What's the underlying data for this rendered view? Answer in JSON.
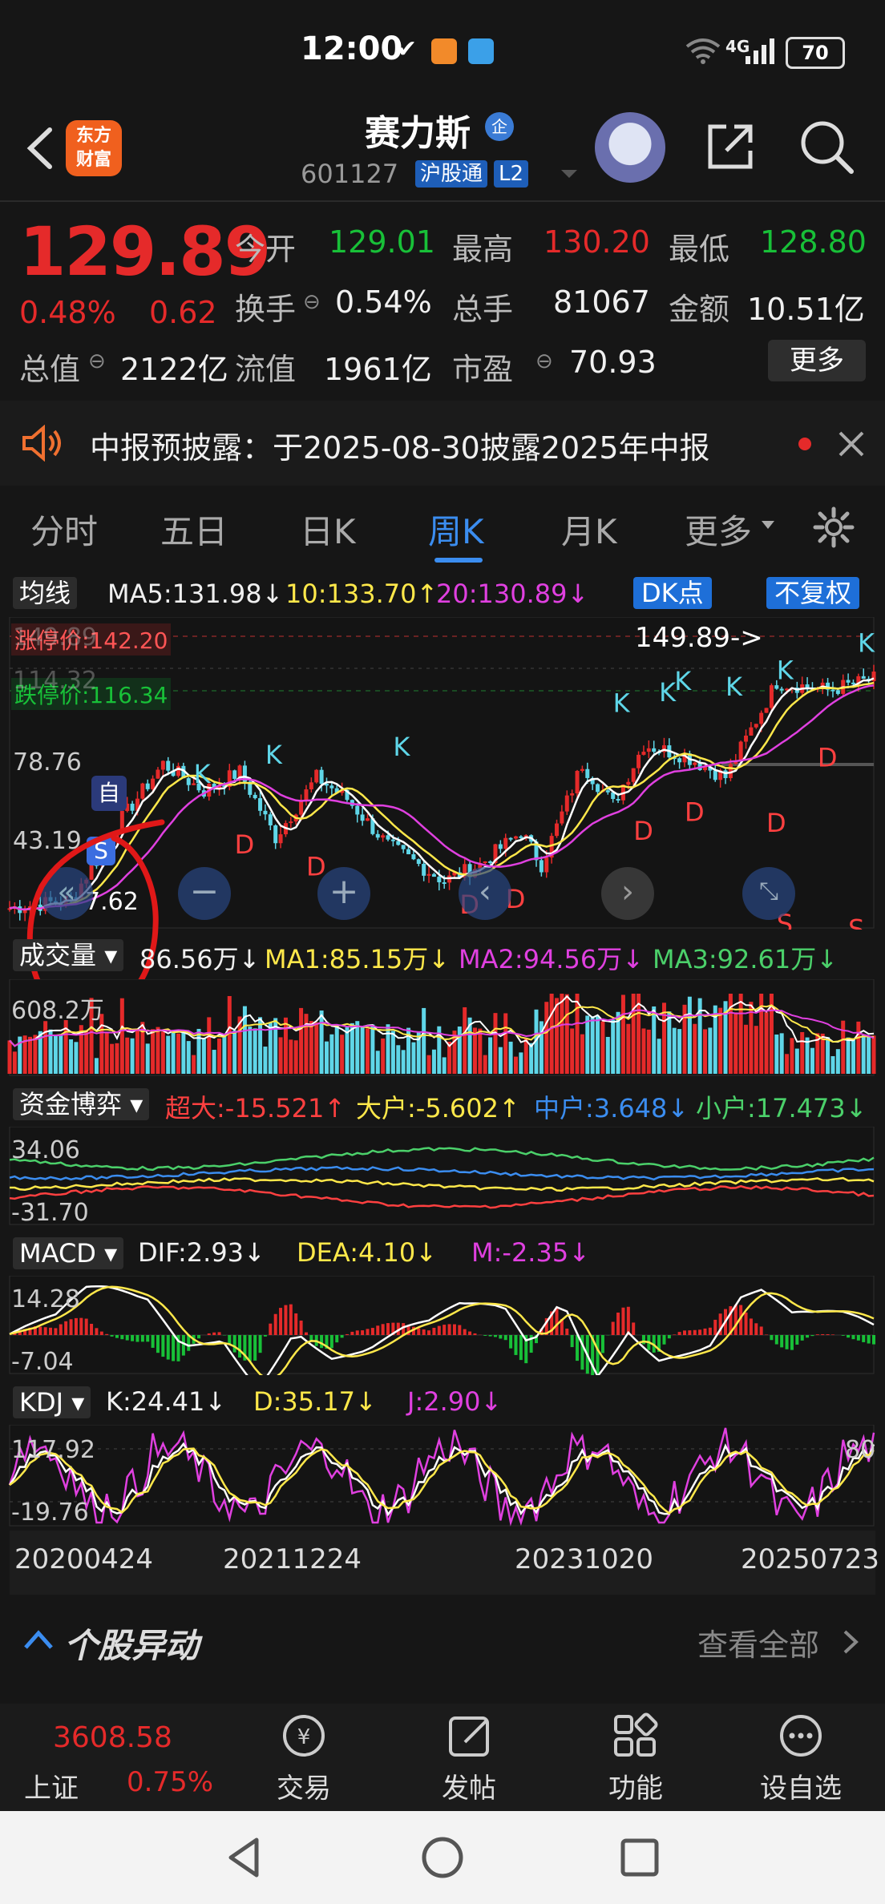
{
  "status_bar": {
    "time": "12:00",
    "network": "4G",
    "battery": "70"
  },
  "header": {
    "logo_text_1": "东方",
    "logo_text_2": "财富",
    "stock_name": "赛力斯",
    "badge": "企",
    "stock_code": "601127",
    "tag_hgt": "沪股通",
    "tag_level": "L2"
  },
  "quote": {
    "price": "129.89",
    "change_pct": "0.48%",
    "change": "0.62",
    "open_label": "今开",
    "open": "129.01",
    "high_label": "最高",
    "high": "130.20",
    "low_label": "最低",
    "low": "128.80",
    "turnover_label": "换手",
    "turnover": "0.54%",
    "volume_label": "总手",
    "volume": "81067",
    "amount_label": "金额",
    "amount": "10.51亿",
    "mktcap_label": "总值",
    "mktcap": "2122亿",
    "float_label": "流值",
    "float": "1961亿",
    "pe_label": "市盈",
    "pe": "70.93",
    "more": "更多"
  },
  "notice": {
    "text": "中报预披露：于2025-08-30披露2025年中报"
  },
  "tabs": [
    "分时",
    "五日",
    "日K",
    "周K",
    "月K",
    "更多"
  ],
  "active_tab": "周K",
  "main_chart": {
    "selector": "均线",
    "ma5": "MA5:131.98↓",
    "ma10": "10:133.70↑",
    "ma20": "20:130.89↓",
    "dk_button": "DK点",
    "adjust_button": "不复权",
    "limit_up": "涨停价:142.20",
    "limit_down": "跌停价:116.34",
    "price_top": "149.89",
    "price_mid": "114.32",
    "price_78": "78.76",
    "price_43": "43.19",
    "price_low": "7.62",
    "max_marker": "149.89->",
    "self_badge": "自",
    "s_badge": "S"
  },
  "volume": {
    "selector": "成交量",
    "ma0": "86.56万↓",
    "ma1": "MA1:85.15万↓",
    "ma2": "MA2:94.56万↓",
    "ma3": "MA3:92.61万↓",
    "axis_top": "608.2万"
  },
  "fund": {
    "selector": "资金博弈",
    "super": "超大:-15.521↑",
    "large": "大户:-5.602↑",
    "mid": "中户:3.648↓",
    "small": "小户:17.473↓",
    "axis_top": "34.06",
    "axis_bottom": "-31.70"
  },
  "macd": {
    "selector": "MACD",
    "dif": "DIF:2.93↓",
    "dea": "DEA:4.10↓",
    "m": "M:-2.35↓",
    "axis_top": "14.28",
    "axis_bottom": "-7.04"
  },
  "kdj": {
    "selector": "KDJ",
    "k": "K:24.41↓",
    "d": "D:35.17↓",
    "j": "J:2.90↓",
    "axis_top": "117.92",
    "axis_bottom": "-19.76",
    "axis_right": "80"
  },
  "dates": [
    "20200424",
    "20211224",
    "20231020",
    "20250723"
  ],
  "section": {
    "title": "个股异动",
    "see_all": "查看全部"
  },
  "bottom_nav": {
    "index_value": "3608.58",
    "index_name": "上证",
    "index_pct": "0.75%",
    "trade": "交易",
    "post": "发帖",
    "functions": "功能",
    "watchlist": "设自选"
  },
  "colors": {
    "up": "#e52a2a",
    "down": "#18c038",
    "accent": "#3b8df0",
    "ma5": "#ffffff",
    "ma10": "#ffe84a",
    "ma20": "#e040e0"
  }
}
